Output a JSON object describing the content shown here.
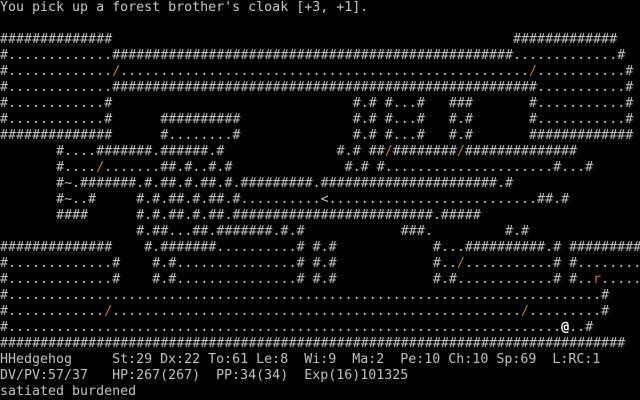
{
  "message": "You pick up a forest brother's cloak [+3, +1].",
  "map_rows": [
    "##############                                                  #############",
    "#.............##################################################.............#",
    "#............./.................................................../...........#",
    "#.............#####################################################...........#",
    "#............#                              #.# #...#   ###       #...........#",
    "#............#      ##########              #.# #...#   #.#       #...........#",
    "##############      #........#              #.# #...#   #.#       #############",
    "       #....#######.######.#              #.# ##/########/##############",
    "       #..../.......##.#..#.#              #.# #.....................#...#",
    "       #~.#######.#.##.#.##.#.#########.######################.#",
    "       #~..#     #.#.##.#.##.#..........<..........................##.#",
    "       ####      #.#.##.#.##.#########################.#####",
    "                 #.##...##.#######.#.#            ###.         #.#",
    "##############    #.#######..........# #.#            #...##########.# #########",
    "#.............#    #.#...............# #.#            #../...........# #.........#",
    "#.............#    #.#...............# #.#            #.#............# #..r.......#",
    "#..........................................................................#",
    "#............/.................................................../.........#",
    "#.....................................................................@..#",
    "##############################################################################"
  ],
  "entities": {
    "player_glyph": "@",
    "monster_glyph": "r",
    "stairs_glyph": "<"
  },
  "status": {
    "line1": "HHedgehog     St:29 Dx:22 To:61 Le:8  Wi:9  Ma:2  Pe:10 Ch:10 Sp:69  L:RC:1",
    "line2": "DV/PV:57/37   HP:267(267)  PP:34(34)  Exp(16)101325",
    "line3": "satiated burdened"
  },
  "colors": {
    "background": "#000000",
    "text": "#c0c0c0",
    "door": "#c87832",
    "player": "#ffffff",
    "monster": "#c87832"
  }
}
